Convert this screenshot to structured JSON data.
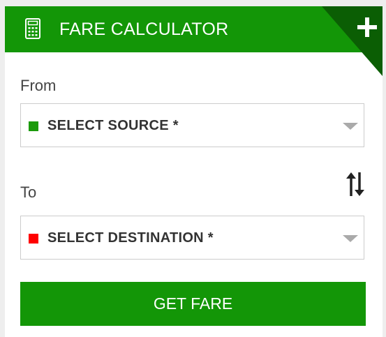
{
  "header": {
    "icon": "calculator-icon",
    "title": "FARE CALCULATOR",
    "expand_icon": "plus-icon",
    "corner_color": "#0b5e04"
  },
  "from": {
    "label": "From",
    "placeholder": "SELECT SOURCE *",
    "marker_color": "#1b9a0b",
    "icon": "chevron-down-icon"
  },
  "to": {
    "label": "To",
    "placeholder": "SELECT DESTINATION *",
    "marker_color": "#ff0000",
    "icon": "chevron-down-icon"
  },
  "swap": {
    "icon": "swap-vertical-arrows-icon"
  },
  "button": {
    "label": "GET FARE"
  },
  "colors": {
    "brand_green": "#139607",
    "text": "#444444"
  }
}
